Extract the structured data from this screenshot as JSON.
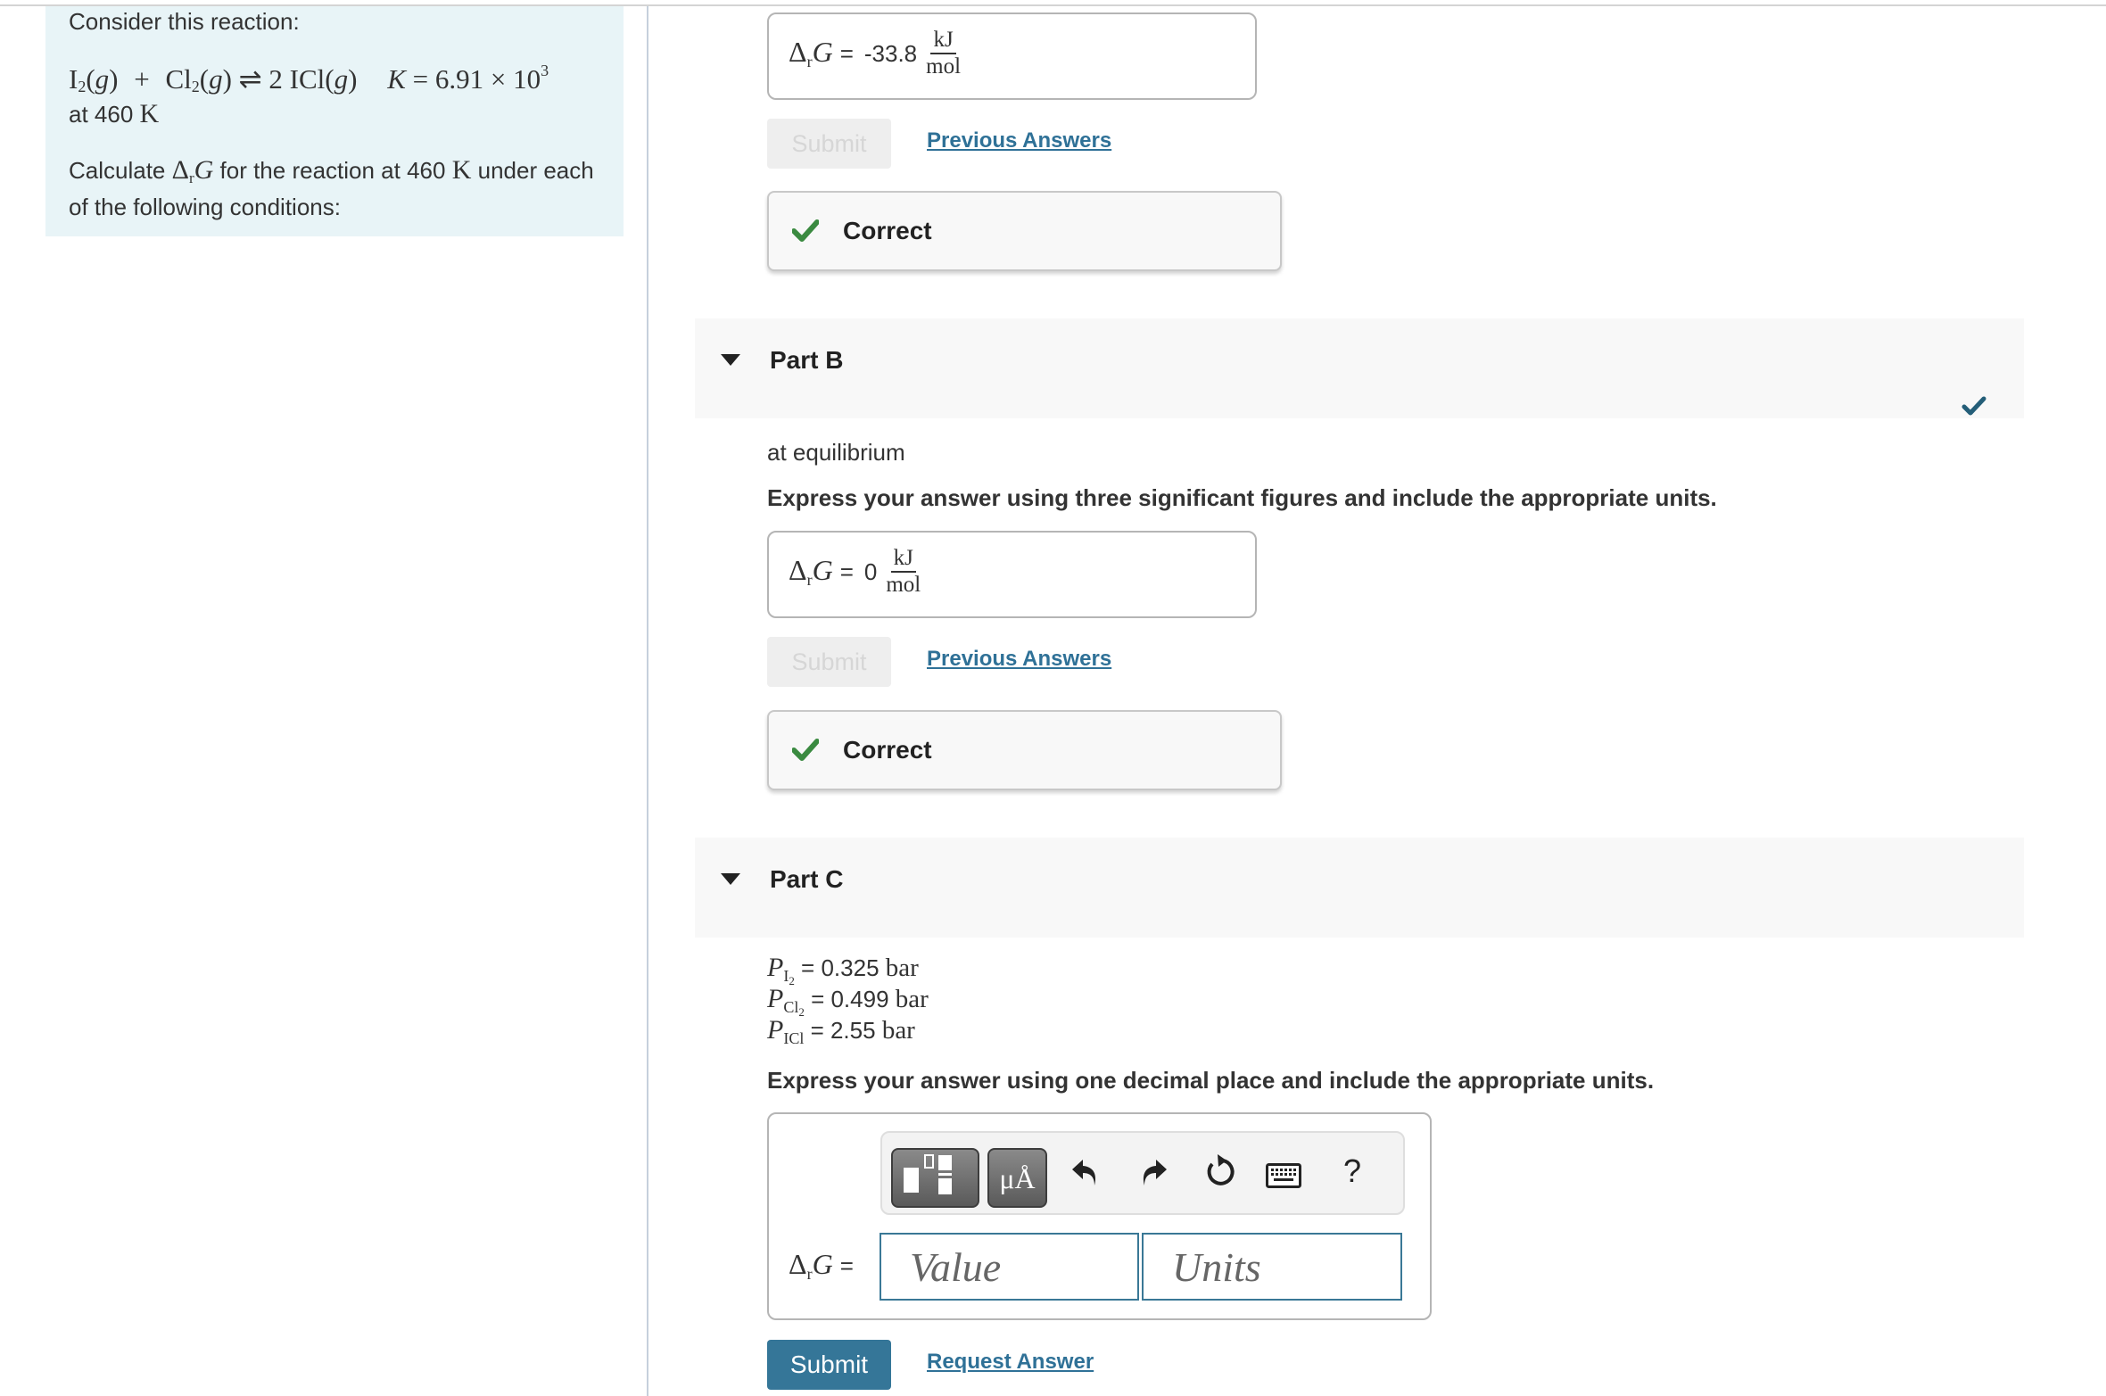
{
  "problem": {
    "intro": "Consider this reaction:",
    "reaction": {
      "reactant1": "I",
      "reactant1_sub": "2",
      "reactant1_state": "(g)",
      "plus": "+",
      "reactant2": "Cl",
      "reactant2_sub": "2",
      "reactant2_state": "(g)",
      "arrow": "⇌",
      "product_coef": "2",
      "product": "ICl",
      "product_state": "(g)",
      "k_symbol": "K",
      "k_equals": "=",
      "k_mantissa": "6.91",
      "k_times": "×",
      "k_base": "10",
      "k_exponent": "3"
    },
    "temp_prefix": "at 460",
    "temp_unit": "K",
    "calc_prefix": "Calculate",
    "calc_symbol_delta": "Δ",
    "calc_symbol_sub": "r",
    "calc_symbol_G": "G",
    "calc_mid": "for the reaction at 460",
    "calc_unit": "K",
    "calc_suffix": "under each of the following conditions:"
  },
  "part_a": {
    "answer": {
      "symbol_delta": "Δ",
      "symbol_sub": "r",
      "symbol_G": "G",
      "equals": "=",
      "value": "-33.8",
      "unit_num": "kJ",
      "unit_den": "mol"
    },
    "submit_label": "Submit",
    "previous_answers_label": "Previous Answers",
    "feedback_label": "Correct"
  },
  "part_b": {
    "title": "Part B",
    "condition": "at equilibrium",
    "instruction": "Express your answer using three significant figures and include the appropriate units.",
    "answer": {
      "symbol_delta": "Δ",
      "symbol_sub": "r",
      "symbol_G": "G",
      "equals": "=",
      "value": "0",
      "unit_num": "kJ",
      "unit_den": "mol"
    },
    "submit_label": "Submit",
    "previous_answers_label": "Previous Answers",
    "feedback_label": "Correct",
    "status": "completed"
  },
  "part_c": {
    "title": "Part C",
    "conditions": [
      {
        "symbol": "P",
        "sub": "I",
        "subsub": "2",
        "text": " = 0.325 ",
        "unit": "bar"
      },
      {
        "symbol": "P",
        "sub": "Cl",
        "subsub": "2",
        "text": " = 0.499 ",
        "unit": "bar"
      },
      {
        "symbol": "P",
        "sub": "ICl",
        "subsub": "",
        "text": " = 2.55 ",
        "unit": "bar"
      }
    ],
    "instruction": "Express your answer using one decimal place and include the appropriate units.",
    "toolbar": {
      "templates_icon": "templates-icon",
      "units_button_label": "μÅ",
      "undo_icon": "undo-icon",
      "redo_icon": "redo-icon",
      "reset_icon": "reset-icon",
      "keyboard_icon": "keyboard-icon",
      "help_label": "?"
    },
    "answer": {
      "symbol_delta": "Δ",
      "symbol_sub": "r",
      "symbol_G": "G",
      "equals": "=",
      "value_placeholder": "Value",
      "value": "",
      "units_placeholder": "Units",
      "units": ""
    },
    "submit_label": "Submit",
    "request_answer_label": "Request Answer"
  },
  "colors": {
    "problem_bg": "#e8f4f7",
    "link": "#2f7197",
    "primary_button": "#357698",
    "correct_check": "#3a8a40",
    "part_complete_check": "#245e78",
    "part_band_bg": "#f8f8f8"
  }
}
